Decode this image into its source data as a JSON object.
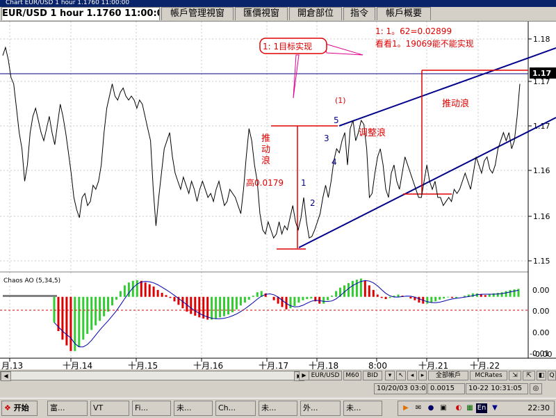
{
  "window": {
    "title": "Chart EUR/USD 1 hour 1.1760 11:00:00"
  },
  "tabs": [
    {
      "label": "EUR/USD 1 hour 1.1760 11:00:00",
      "active": true
    },
    {
      "label": "帳戶管理視窗",
      "active": false
    },
    {
      "label": "匯價視窗",
      "active": false
    },
    {
      "label": "開倉部位",
      "active": false
    },
    {
      "label": "指令",
      "active": false
    },
    {
      "label": "帳戶概要",
      "active": false
    }
  ],
  "chart_data": {
    "type": "line",
    "title": "",
    "xlabel": "",
    "ylabel": "",
    "ylim": [
      1.1535,
      1.183
    ],
    "grid": true,
    "x_ticks": [
      "月.13",
      "十月.14",
      "十月.15",
      "十月.16",
      "十月.17",
      "十月.18",
      "8:00",
      "十月.21",
      "十月.22"
    ],
    "y_ticks": [
      "1.18",
      "1.17",
      "1.17",
      "1.16",
      "1.16",
      "1.15"
    ],
    "price_label": "1.17",
    "series": [
      {
        "name": "",
        "values": [
          1.1795,
          1.1805,
          1.179,
          1.1768,
          1.176,
          1.173,
          1.17,
          1.168,
          1.164,
          1.166,
          1.17,
          1.172,
          1.173,
          1.1715,
          1.17,
          1.169,
          1.1705,
          1.172,
          1.17,
          1.1685,
          1.171,
          1.1735,
          1.172,
          1.17,
          1.1675,
          1.165,
          1.162,
          1.1605,
          1.1595,
          1.162,
          1.1625,
          1.161,
          1.1615,
          1.1635,
          1.163,
          1.164,
          1.166,
          1.17,
          1.173,
          1.1745,
          1.176,
          1.1745,
          1.174,
          1.175,
          1.1755,
          1.1745,
          1.174,
          1.1745,
          1.174,
          1.173,
          1.174,
          1.1735,
          1.172,
          1.1705,
          1.169,
          1.163,
          1.1585,
          1.162,
          1.165,
          1.168,
          1.169,
          1.17,
          1.167,
          1.165,
          1.164,
          1.163,
          1.1645,
          1.1635,
          1.1625,
          1.164,
          1.163,
          1.1615,
          1.163,
          1.164,
          1.163,
          1.162,
          1.1625,
          1.1615,
          1.163,
          1.164,
          1.1625,
          1.161,
          1.1615,
          1.163,
          1.1625,
          1.162,
          1.161,
          1.16,
          1.163,
          1.167,
          1.1705,
          1.169,
          1.166,
          1.164,
          1.16,
          1.158,
          1.1575,
          1.159,
          1.158,
          1.157,
          1.1575,
          1.159,
          1.1575,
          1.1585,
          1.158,
          1.1595,
          1.161,
          1.159,
          1.158,
          1.1595,
          1.162,
          1.159,
          1.157,
          1.1572,
          1.158,
          1.159,
          1.16,
          1.162,
          1.1635,
          1.162,
          1.164,
          1.1665,
          1.168,
          1.1675,
          1.169,
          1.17,
          1.166,
          1.1705,
          1.1715,
          1.169,
          1.17,
          1.1715,
          1.171,
          1.168,
          1.162,
          1.1625,
          1.165,
          1.167,
          1.168,
          1.166,
          1.163,
          1.162,
          1.165,
          1.166,
          1.164,
          1.163,
          1.165,
          1.167,
          1.166,
          1.165,
          1.164,
          1.163,
          1.162,
          1.162,
          1.164,
          1.166,
          1.164,
          1.163,
          1.164,
          1.162,
          1.162,
          1.161,
          1.1615,
          1.162,
          1.1615,
          1.163,
          1.1625,
          1.163,
          1.164,
          1.165,
          1.164,
          1.163,
          1.165,
          1.167,
          1.166,
          1.165,
          1.1665,
          1.167,
          1.1655,
          1.165,
          1.166,
          1.168,
          1.169,
          1.17,
          1.169,
          1.17,
          1.168,
          1.169,
          1.172,
          1.176
        ]
      }
    ],
    "indicator": {
      "name": "Chaos AO (5,34,5)",
      "y_ticks": [
        "0.00",
        "0.00",
        "0.00",
        "-0.00",
        "-0.01"
      ],
      "ylim": [
        -0.0105,
        0.0035
      ],
      "values": [
        -0.0045,
        -0.006,
        -0.0075,
        -0.0085,
        -0.0095,
        -0.0095,
        -0.0088,
        -0.0075,
        -0.0065,
        -0.0058,
        -0.005,
        -0.0042,
        -0.0034,
        -0.0026,
        -0.0015,
        -0.0005,
        0.001,
        0.002,
        0.0025,
        0.0028,
        0.0029,
        0.0028,
        0.0025,
        0.0022,
        0.0018,
        0.0012,
        0.0007,
        0.0003,
        -0.0002,
        -0.0008,
        -0.0014,
        -0.002,
        -0.0026,
        -0.003,
        -0.0033,
        -0.0036,
        -0.0038,
        -0.004,
        -0.004,
        -0.0038,
        -0.0036,
        -0.0034,
        -0.0031,
        -0.0027,
        -0.0022,
        -0.0015,
        -0.001,
        -0.0005,
        0.0002,
        0.0008,
        0.001,
        0.0006,
        0.0,
        -0.0006,
        -0.0012,
        -0.0018,
        -0.0022,
        -0.002,
        -0.0016,
        -0.001,
        -0.0006,
        -0.0004,
        -0.0003,
        -0.0008,
        -0.0012,
        -0.0012,
        -0.0006,
        0.0002,
        0.001,
        0.0016,
        0.002,
        0.0024,
        0.0028,
        0.003,
        0.0032,
        0.0028,
        0.002,
        0.0012,
        0.0004,
        -0.0002,
        -0.0004,
        -0.0002,
        0.0002,
        0.0004,
        0.0002,
        0.0,
        -0.0003,
        -0.0006,
        -0.001,
        -0.0012,
        -0.0012,
        -0.001,
        -0.0008,
        -0.0005,
        -0.0003,
        -0.0001,
        -0.0002,
        -0.0002,
        0.0,
        0.0002,
        0.0004,
        0.0006,
        0.0006,
        0.0004,
        0.0003,
        0.0004,
        0.0006,
        0.0007,
        0.0008,
        0.001,
        0.0012,
        0.0013,
        0.0014
      ]
    },
    "annotations": {
      "target_box": "1: 1目标实现",
      "note_line1": "1: 1。62=0.02899",
      "note_line2": "看看1。19069能不能实现",
      "wave_paren": "(1)",
      "label_5": "5",
      "label_3": "3",
      "label_4": "4",
      "label_1": "1",
      "label_2": "2",
      "push_wave_left": "推动浪",
      "push_wave_right": "推动浪",
      "correction_wave": "调整浪",
      "height_note": "高0.0179"
    }
  },
  "chart_tabs": [
    "EUR/USD",
    "M60",
    "BID"
  ],
  "toolbar2": {
    "all_accounts": "全部帳戶",
    "mcrates": "MCRates"
  },
  "status": {
    "left": "10/20/03 03:00",
    "mid": "0.0015",
    "right": "10-22 10:31:05"
  },
  "taskbar": {
    "start": "开始",
    "items": [
      "富...",
      "VT",
      "Fi...",
      "未...",
      "Ch...",
      "未...",
      "外...",
      "未..."
    ],
    "tray_lang": "En",
    "clock": "22:30"
  }
}
